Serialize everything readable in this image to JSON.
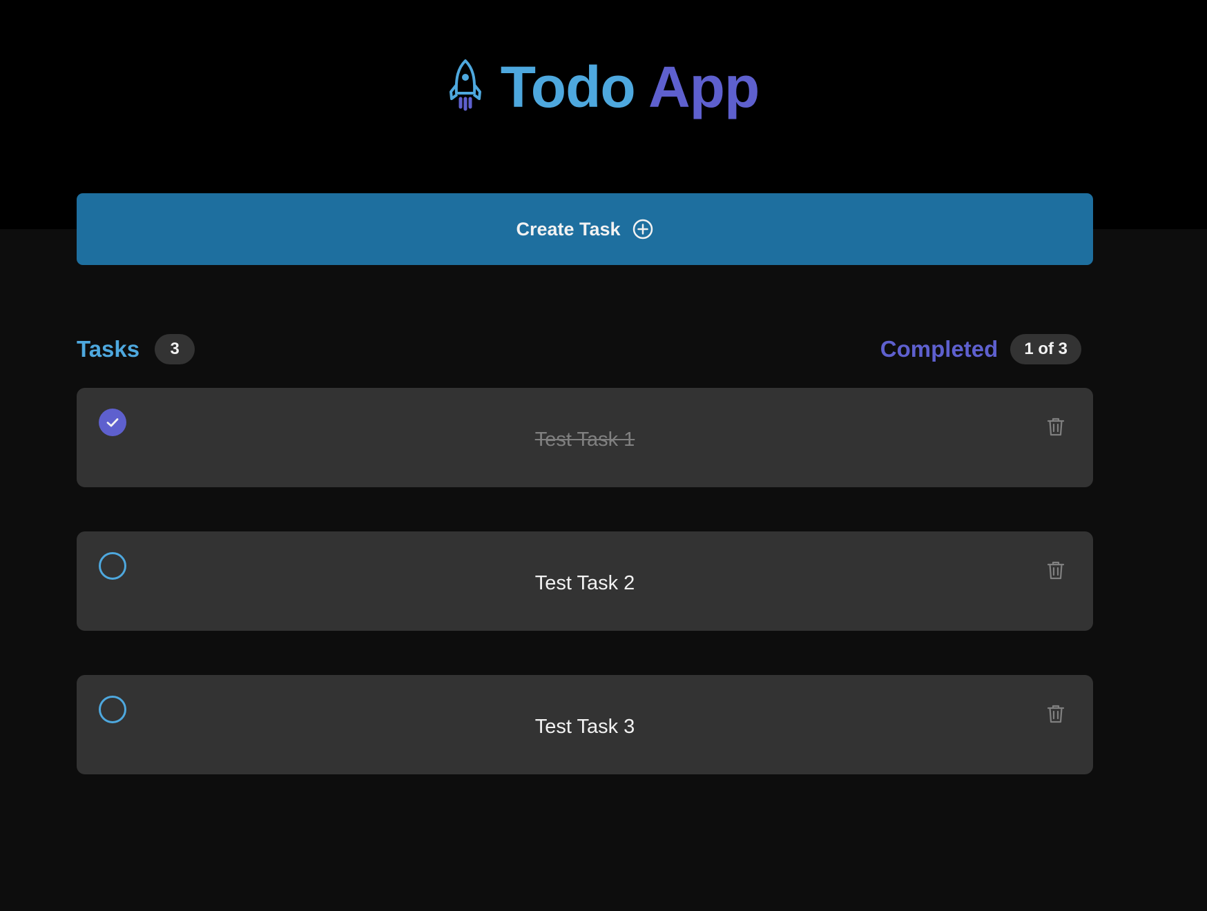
{
  "app": {
    "title_part1": "Todo",
    "title_part2": "App",
    "logo_icon": "rocket-icon"
  },
  "create_button": {
    "label": "Create Task",
    "icon": "plus-circle-icon"
  },
  "summary": {
    "tasks_label": "Tasks",
    "tasks_count": "3",
    "completed_label": "Completed",
    "completed_count": "1 of 3"
  },
  "tasks": [
    {
      "text": "Test Task 1",
      "completed": true
    },
    {
      "text": "Test Task 2",
      "completed": false
    },
    {
      "text": "Test Task 3",
      "completed": false
    }
  ],
  "colors": {
    "header_bg": "#000000",
    "page_bg": "#0d0d0d",
    "blue": "#4ea8de",
    "purple": "#5e60ce",
    "button_bg": "#1e6f9f",
    "card_bg": "#333333"
  }
}
